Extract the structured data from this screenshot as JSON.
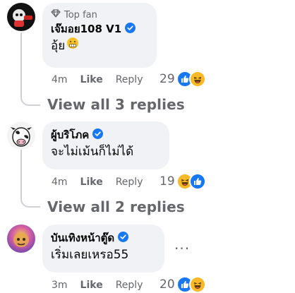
{
  "comments": [
    {
      "badge": "Top fan",
      "author": "เจ๊มอย108 V1",
      "text": "อุ้ย",
      "time": "4m",
      "like": "Like",
      "reply": "Reply",
      "reaction_count": "29",
      "reactions": [
        "like-icon",
        "haha-icon"
      ],
      "view_replies": "View all 3 replies"
    },
    {
      "author": "ผู้บริโภค",
      "text": "จะไม่เม้นก็ไม่ได้",
      "time": "4m",
      "like": "Like",
      "reply": "Reply",
      "reaction_count": "19",
      "reactions": [
        "haha-icon",
        "like-icon"
      ],
      "view_replies": "View all 2 replies"
    },
    {
      "author": "บันเทิงหน้าตู๊ด",
      "text": "เริ่มเลยเหรอ55",
      "time": "3m",
      "like": "Like",
      "reply": "Reply",
      "reaction_count": "20",
      "reactions": [
        "like-icon",
        "haha-icon"
      ],
      "more": "···"
    }
  ],
  "colors": {
    "like_blue": "#1877f2",
    "haha_yellow": "#f7b928",
    "verified_blue": "#1877f2",
    "secondary_text": "#65676b",
    "bubble_bg": "#f0f2f5"
  }
}
